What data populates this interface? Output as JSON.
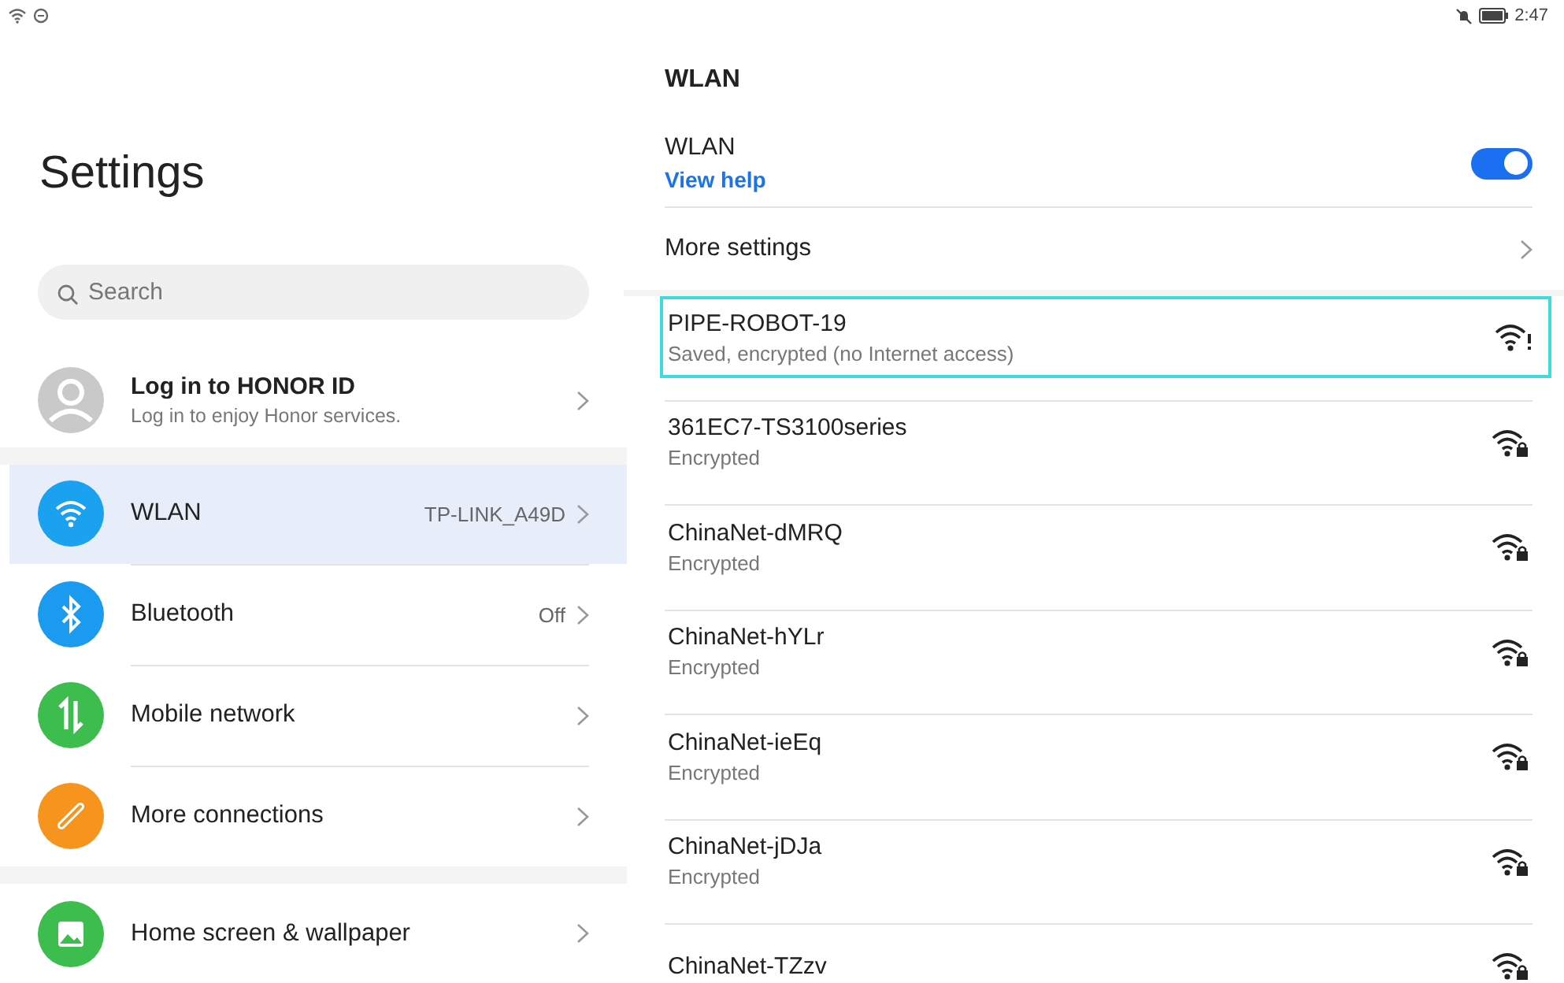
{
  "status_bar": {
    "time": "2:47"
  },
  "sidebar": {
    "title": "Settings",
    "search": {
      "placeholder": "Search"
    },
    "account": {
      "title": "Log in to HONOR ID",
      "subtitle": "Log in to enjoy Honor services."
    },
    "sections": [
      {
        "items": [
          {
            "kind": "wifi",
            "label": "WLAN",
            "value": "TP-LINK_A49D",
            "color": "#1aa1f0",
            "selected": true
          },
          {
            "kind": "bluetooth",
            "label": "Bluetooth",
            "value": "Off",
            "color": "#1a9bef",
            "selected": false
          },
          {
            "kind": "mobile",
            "label": "Mobile network",
            "color": "#3ebd4f",
            "selected": false
          },
          {
            "kind": "link",
            "label": "More connections",
            "color": "#f7941d",
            "selected": false
          }
        ]
      },
      {
        "items": [
          {
            "kind": "image",
            "label": "Home screen & wallpaper",
            "color": "#3ebd4f",
            "selected": false
          }
        ]
      }
    ]
  },
  "detail": {
    "title": "WLAN",
    "wlan_toggle": {
      "label": "WLAN",
      "help_link": "View help",
      "on": true
    },
    "more_settings": "More settings",
    "networks": [
      {
        "kind": "no-internet",
        "name": "PIPE-ROBOT-19",
        "status": "Saved, encrypted (no Internet access)",
        "selected": true
      },
      {
        "kind": "locked",
        "name": "361EC7-TS3100series",
        "status": "Encrypted",
        "selected": false
      },
      {
        "kind": "locked",
        "name": "ChinaNet-dMRQ",
        "status": "Encrypted",
        "selected": false
      },
      {
        "kind": "locked",
        "name": "ChinaNet-hYLr",
        "status": "Encrypted",
        "selected": false
      },
      {
        "kind": "locked",
        "name": "ChinaNet-ieEq",
        "status": "Encrypted",
        "selected": false
      },
      {
        "kind": "locked",
        "name": "ChinaNet-jDJa",
        "status": "Encrypted",
        "selected": false
      },
      {
        "kind": "locked",
        "name": "ChinaNet-TZzv",
        "selected": false
      }
    ]
  }
}
